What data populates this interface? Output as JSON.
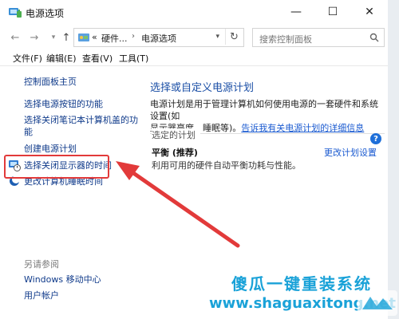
{
  "window": {
    "title": "电源选项",
    "controls": {
      "minimize": "—",
      "maximize": "☐",
      "close": "✕"
    }
  },
  "nav": {
    "back": "←",
    "forward": "→",
    "dropdown": "▾",
    "up": "↑",
    "address_segments": [
      "硬件...",
      "电源选项"
    ],
    "address_prefix": "«",
    "address_chevron": "›",
    "address_dropdown": "▾",
    "refresh": "↻",
    "search_placeholder": "搜索控制面板"
  },
  "menu": {
    "items": [
      "文件(F)",
      "编辑(E)",
      "查看(V)",
      "工具(T)"
    ]
  },
  "sidebar": {
    "home": "控制面板主页",
    "links": [
      "选择电源按钮的功能",
      "选择关闭笔记本计算机盖的功",
      "能",
      "创建电源计划",
      "选择关闭显示器的时间",
      "更改计算机睡眠时间"
    ],
    "see_also": "另请参阅",
    "see_also_links": [
      "Windows 移动中心",
      "用户帐户"
    ]
  },
  "main": {
    "title": "选择或自定义电源计划",
    "desc_line1": "电源计划是用于管理计算机如何使用电源的一套硬件和系统设置(如",
    "desc_line2_prefix": "显示器亮度、睡眠等)。",
    "desc_link": "告诉我有关电源计划的详细信息",
    "plan_header": "选定的计划",
    "plan_name": "平衡 (推荐)",
    "plan_change": "更改计划设置",
    "plan_desc": "利用可用的硬件自动平衡功耗与性能。",
    "help": "?"
  },
  "watermark": {
    "text_cn": "傻瓜一键重装系统",
    "url": "www.shaguaxitong.net"
  },
  "colors": {
    "link": "#0f3a8a",
    "accent_link": "#1a5ad0",
    "title_blue": "#1b4fa6",
    "highlight_red": "#e23a3a",
    "watermark": "#1aa2d8"
  }
}
